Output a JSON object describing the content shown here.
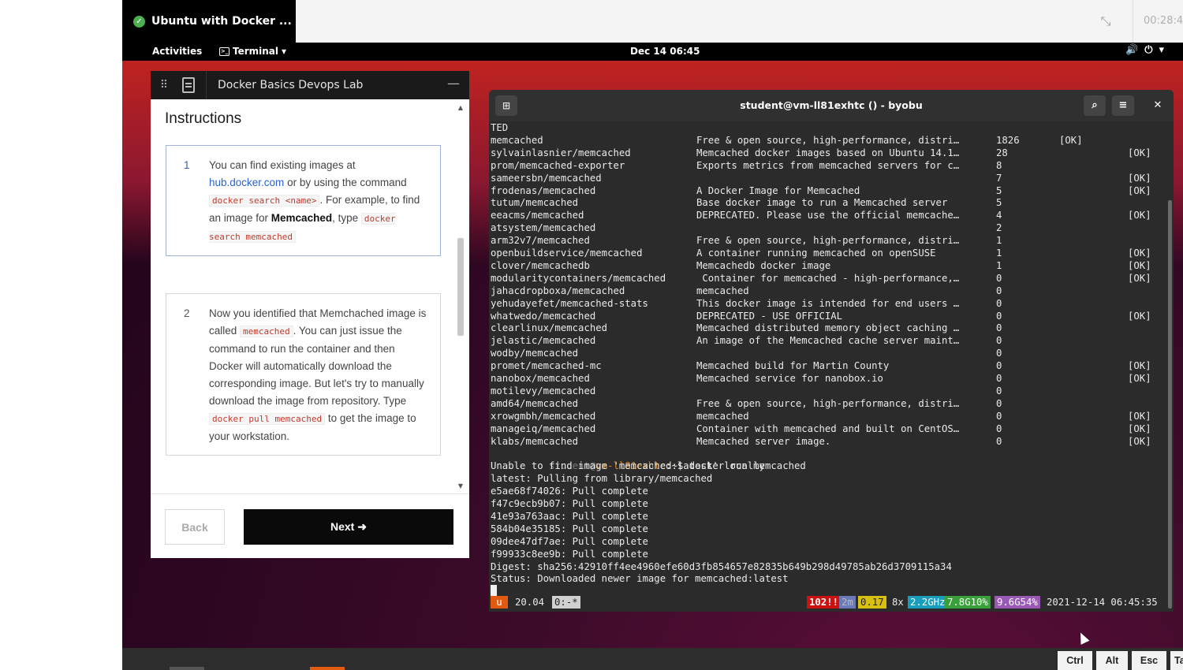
{
  "session": {
    "title": "Ubuntu with Docker ...",
    "timer": "00:28:4"
  },
  "gnome": {
    "activities": "Activities",
    "app_menu": "Terminal",
    "clock": "Dec 14  06:45"
  },
  "instructions": {
    "lab_title": "Docker Basics Devops Lab",
    "heading": "Instructions",
    "steps": [
      {
        "num": "1",
        "t1": "You can find existing images at ",
        "link": "hub.docker.com",
        "t2": " or by using the command ",
        "code1": "docker search <name>",
        "t3": ". For example, to find an image for ",
        "bold": "Memcached",
        "t4": ", type ",
        "code2": "docker search memcached"
      },
      {
        "num": "2",
        "t1": "Now you identified that Memchached image is called ",
        "code1": "memcached",
        "t2": ". You can just issue the command to run the container and then Docker will automatically download the corresponding image. But let's try to manually download the image from repository. Type ",
        "code2": "docker pull memcached",
        "t3": " to get the image to your workstation."
      }
    ],
    "back_label": "Back",
    "next_label": "Next"
  },
  "terminal": {
    "title": "student@vm-ll81exhtc () - byobu",
    "prev_line": "TED",
    "rows": [
      {
        "name": "memcached",
        "desc": "Free & open source, high-performance, distri…",
        "stars": "1826",
        "official": "[OK]",
        "automated": ""
      },
      {
        "name": "sylvainlasnier/memcached",
        "desc": "Memcached docker images based on Ubuntu 14.1…",
        "stars": "28",
        "official": "",
        "automated": "[OK]"
      },
      {
        "name": "prom/memcached-exporter",
        "desc": "Exports metrics from memcached servers for c…",
        "stars": "8",
        "official": "",
        "automated": ""
      },
      {
        "name": "sameersbn/memcached",
        "desc": "",
        "stars": "7",
        "official": "",
        "automated": "[OK]"
      },
      {
        "name": "frodenas/memcached",
        "desc": "A Docker Image for Memcached",
        "stars": "5",
        "official": "",
        "automated": "[OK]"
      },
      {
        "name": "tutum/memcached",
        "desc": "Base docker image to run a Memcached server",
        "stars": "5",
        "official": "",
        "automated": ""
      },
      {
        "name": "eeacms/memcached",
        "desc": "DEPRECATED. Please use the official memcache…",
        "stars": "4",
        "official": "",
        "automated": "[OK]"
      },
      {
        "name": "atsystem/memcached",
        "desc": "",
        "stars": "2",
        "official": "",
        "automated": ""
      },
      {
        "name": "arm32v7/memcached",
        "desc": "Free & open source, high-performance, distri…",
        "stars": "1",
        "official": "",
        "automated": ""
      },
      {
        "name": "openbuildservice/memcached",
        "desc": "A container running memcached on openSUSE",
        "stars": "1",
        "official": "",
        "automated": "[OK]"
      },
      {
        "name": "clover/memcachedb",
        "desc": "Memcachedb docker image",
        "stars": "1",
        "official": "",
        "automated": "[OK]"
      },
      {
        "name": "modularitycontainers/memcached",
        "desc": " Container for memcached - high-performance,…",
        "stars": "0",
        "official": "",
        "automated": "[OK]"
      },
      {
        "name": "jahacdropboxa/memcached",
        "desc": "memcached",
        "stars": "0",
        "official": "",
        "automated": ""
      },
      {
        "name": "yehudayefet/memcached-stats",
        "desc": "This docker image is intended for end users …",
        "stars": "0",
        "official": "",
        "automated": ""
      },
      {
        "name": "whatwedo/memcached",
        "desc": "DEPRECATED - USE OFFICIAL",
        "stars": "0",
        "official": "",
        "automated": "[OK]"
      },
      {
        "name": "clearlinux/memcached",
        "desc": "Memcached distributed memory object caching …",
        "stars": "0",
        "official": "",
        "automated": ""
      },
      {
        "name": "jelastic/memcached",
        "desc": "An image of the Memcached cache server maint…",
        "stars": "0",
        "official": "",
        "automated": ""
      },
      {
        "name": "wodby/memcached",
        "desc": "",
        "stars": "0",
        "official": "",
        "automated": ""
      },
      {
        "name": "promet/memcached-mc",
        "desc": "Memcached build for Martin County",
        "stars": "0",
        "official": "",
        "automated": "[OK]"
      },
      {
        "name": "nanobox/memcached",
        "desc": "Memcached service for nanobox.io",
        "stars": "0",
        "official": "",
        "automated": "[OK]"
      },
      {
        "name": "motilevy/memcached",
        "desc": "",
        "stars": "0",
        "official": "",
        "automated": ""
      },
      {
        "name": "amd64/memcached",
        "desc": "Free & open source, high-performance, distri…",
        "stars": "0",
        "official": "",
        "automated": ""
      },
      {
        "name": "xrowgmbh/memcached",
        "desc": "memcached",
        "stars": "0",
        "official": "",
        "automated": "[OK]"
      },
      {
        "name": "manageiq/memcached",
        "desc": "Container with memcached and built on CentOS…",
        "stars": "0",
        "official": "",
        "automated": "[OK]"
      },
      {
        "name": "klabs/memcached",
        "desc": "Memcached server image.",
        "stars": "0",
        "official": "",
        "automated": "[OK]"
      }
    ],
    "prompt_user": "student",
    "prompt_host": "vm-ll81exhtc",
    "prompt_rest": ":~$ ",
    "command": "docker run memcached",
    "output": [
      "Unable to find image 'memcached:latest' locally",
      "latest: Pulling from library/memcached",
      "e5ae68f74026: Pull complete",
      "f47c9ecb9b07: Pull complete",
      "41e93a763aac: Pull complete",
      "584b04e35185: Pull complete",
      "09dee47df7ae: Pull complete",
      "f99933c8ee9b: Pull complete",
      "Digest: sha256:42910ff4ee4960efe60d3fb854657e82835b649b298d49785ab26d3709115a34",
      "Status: Downloaded newer image for memcached:latest"
    ],
    "status": {
      "win": "u",
      "release": "20.04",
      "session": "0:-*",
      "updates": "102!!",
      "uptime": "2m",
      "load": "0.17",
      "cpu": "8x",
      "cpu_freq": "2.2GHz",
      "mem": "7.8G10%",
      "disk": "9.6G54%",
      "datetime": "2021-12-14 06:45:35"
    }
  },
  "keys": {
    "ctrl": "Ctrl",
    "alt": "Alt",
    "esc": "Esc",
    "tab": "Tab"
  }
}
